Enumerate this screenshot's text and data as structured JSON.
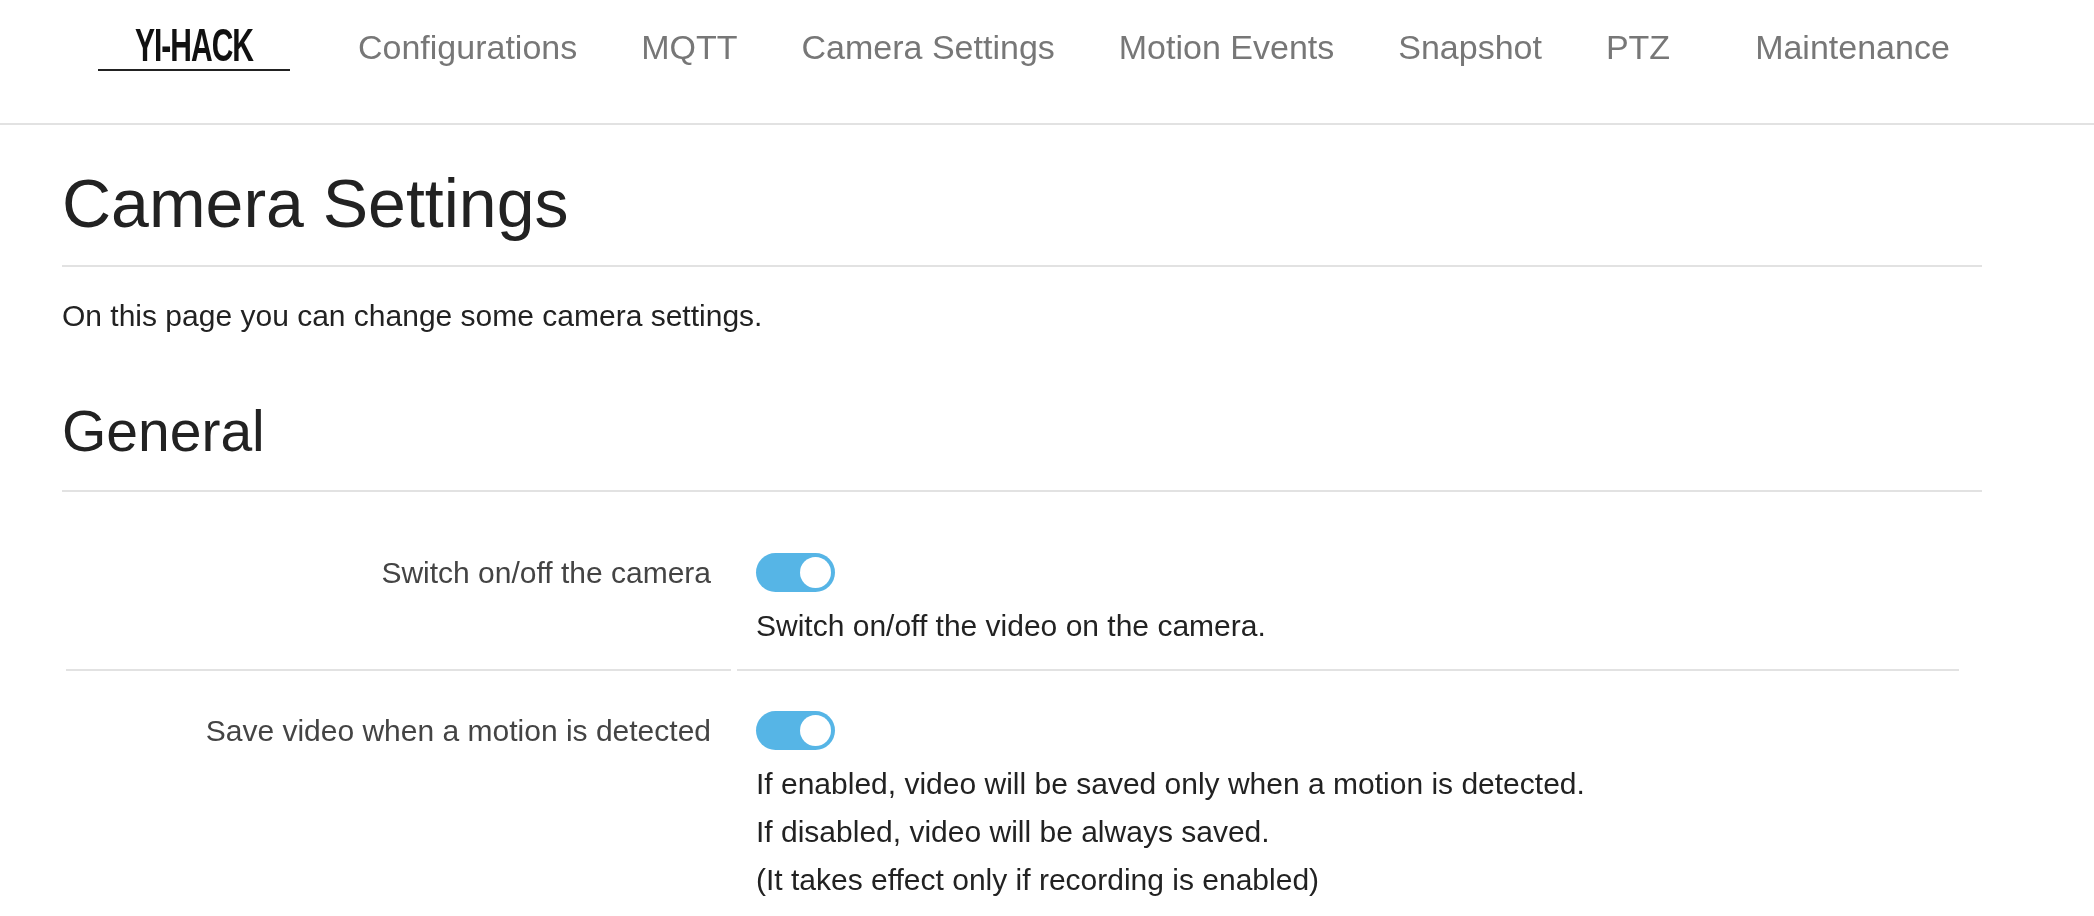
{
  "header": {
    "logo": "YI-HACK",
    "nav": [
      "Configurations",
      "MQTT",
      "Camera Settings",
      "Motion Events",
      "Snapshot",
      "PTZ",
      "Maintenance"
    ]
  },
  "page": {
    "title": "Camera Settings",
    "intro": "On this page you can change some camera settings."
  },
  "sections": [
    {
      "title": "General",
      "settings": [
        {
          "label": "Switch on/off the camera",
          "on": true,
          "description": [
            "Switch on/off the video on the camera."
          ]
        },
        {
          "label": "Save video when a motion is detected",
          "on": true,
          "description": [
            "If enabled, video will be saved only when a motion is detected.",
            "If disabled, video will be always saved.",
            "(It takes effect only if recording is enabled)"
          ]
        }
      ]
    }
  ]
}
